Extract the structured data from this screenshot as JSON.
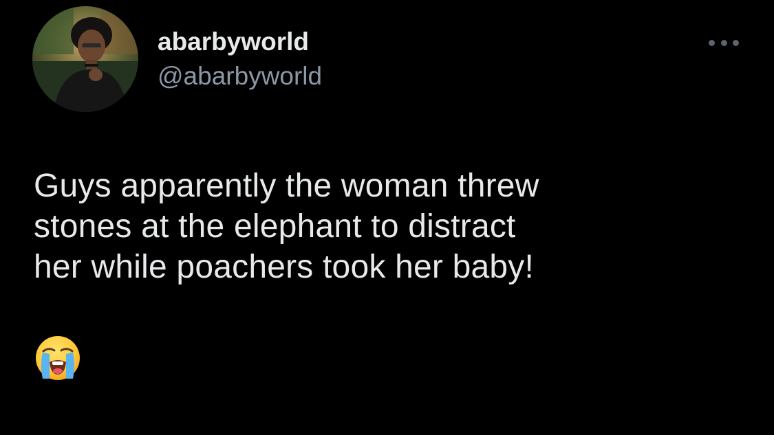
{
  "tweet": {
    "author": {
      "display_name": "abarbyworld",
      "handle": "@abarbyworld",
      "avatar_icon": "profile-photo"
    },
    "more_icon": "more-options-icon",
    "text": "Guys apparently the woman threw\nstones at the elephant to distract\nher while poachers took her baby!",
    "emoji_icon": "loudly-crying-face"
  },
  "colors": {
    "background": "#000000",
    "primary_text": "#e7e9ea",
    "secondary_text": "#8b98a5",
    "dots": "#5b6470"
  }
}
